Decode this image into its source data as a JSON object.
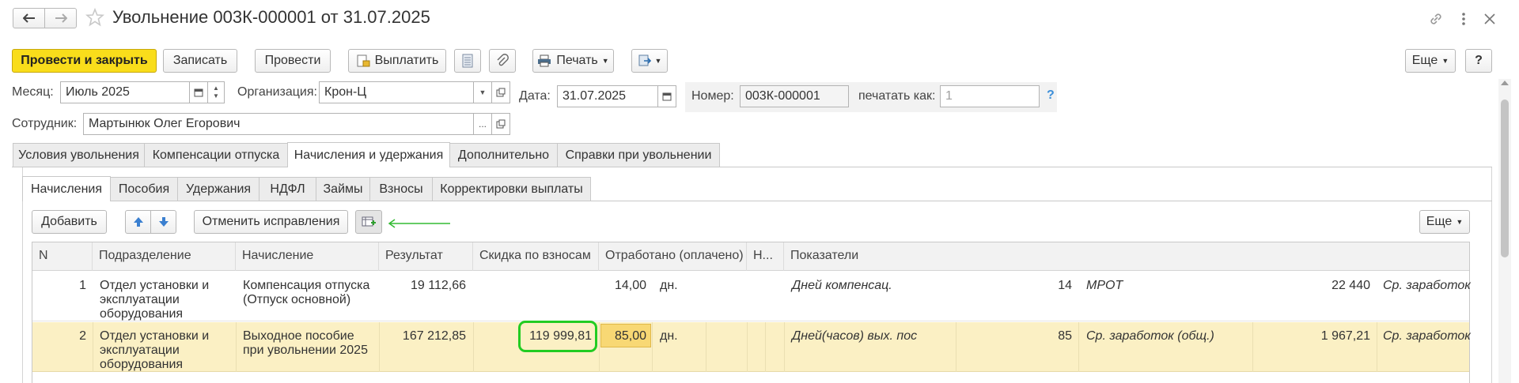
{
  "window": {
    "title": "Увольнение 003К-000001 от 31.07.2025",
    "back_icon": "arrow-left-icon",
    "forward_icon": "arrow-right-icon",
    "favorite_icon": "star-icon",
    "link_icon": "link-icon",
    "menu_icon": "more-vertical-icon",
    "close_icon": "close-icon"
  },
  "toolbar": {
    "post_and_close": "Провести и закрыть",
    "save": "Записать",
    "post": "Провести",
    "pay": "Выплатить",
    "print": "Печать",
    "more": "Еще",
    "help": "?"
  },
  "form": {
    "month_label": "Месяц:",
    "month_value": "Июль 2025",
    "org_label": "Организация:",
    "org_value": "Крон-Ц",
    "date_label": "Дата:",
    "date_value": "31.07.2025",
    "number_label": "Номер:",
    "number_value": "003К-000001",
    "print_as_label": "печатать как:",
    "print_as_placeholder": "1",
    "print_as_help": "?",
    "employee_label": "Сотрудник:",
    "employee_value": "Мартынюк Олег Егорович",
    "ellipsis": "..."
  },
  "main_tabs": [
    {
      "label": "Условия увольнения"
    },
    {
      "label": "Компенсации отпуска"
    },
    {
      "label": "Начисления и удержания"
    },
    {
      "label": "Дополнительно"
    },
    {
      "label": "Справки при увольнении"
    }
  ],
  "sub_tabs": [
    {
      "label": "Начисления"
    },
    {
      "label": "Пособия"
    },
    {
      "label": "Удержания"
    },
    {
      "label": "НДФЛ"
    },
    {
      "label": "Займы"
    },
    {
      "label": "Взносы"
    },
    {
      "label": "Корректировки выплаты"
    }
  ],
  "table_toolbar": {
    "add": "Добавить",
    "undo_corrections": "Отменить исправления",
    "more": "Еще"
  },
  "table": {
    "columns": [
      "N",
      "Подразделение",
      "Начисление",
      "Результат",
      "Скидка по взносам",
      "Отработано (оплачено)",
      "Н...",
      "Показатели"
    ],
    "rows": [
      {
        "n": "1",
        "dept": [
          "Отдел установки и",
          "эксплуатации",
          "оборудования"
        ],
        "accrual": [
          "Компенсация отпуска",
          "(Отпуск основной)"
        ],
        "result": "19 112,66",
        "discount": "",
        "worked": "14,00",
        "unit": "дн.",
        "ind1_name": "Дней компенсац.",
        "ind1_value": "14",
        "ind2_name": "МРОТ",
        "ind2_value": "22 440",
        "ind3_name": "Ср. заработок"
      },
      {
        "n": "2",
        "dept": [
          "Отдел установки и",
          "эксплуатации",
          "оборудования"
        ],
        "accrual": [
          "Выходное пособие",
          "при увольнении 2025"
        ],
        "result": "167 212,85",
        "discount": "119 999,81",
        "worked": "85,00",
        "unit": "дн.",
        "ind1_name": "Дней(часов) вых. пос",
        "ind1_value": "85",
        "ind2_name": "Ср. заработок (общ.)",
        "ind2_value": "1 967,21",
        "ind3_name": "Ср. заработок"
      }
    ]
  },
  "colors": {
    "accent_yellow": "#f9dd1b",
    "selected_row": "#fbf0c4",
    "highlight_green": "#22cc22",
    "help_blue": "#3d8fd9"
  }
}
